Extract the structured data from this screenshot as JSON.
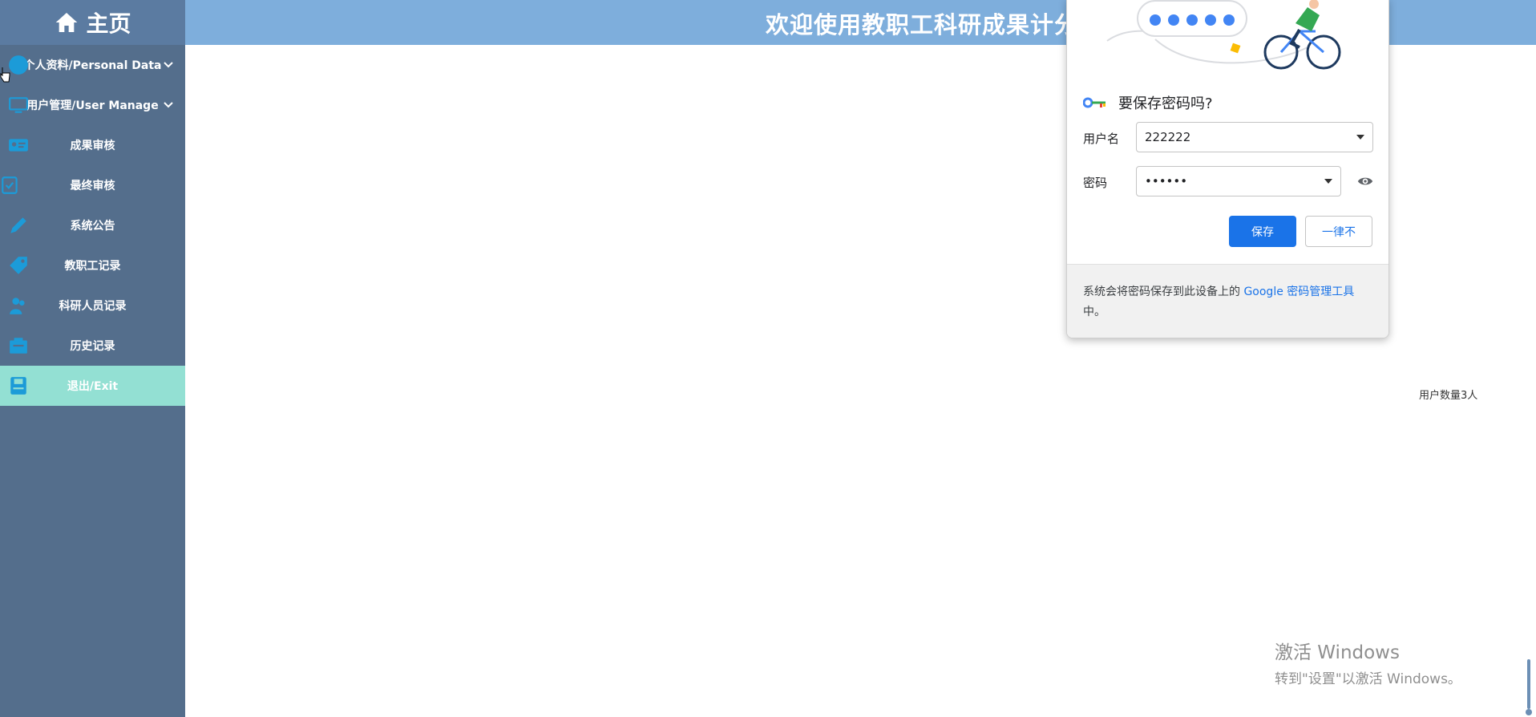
{
  "header": {
    "home_label": "主页",
    "page_heading": "欢迎使用教职工科研成果计分"
  },
  "sidebar": {
    "items": [
      {
        "label": "个人资料/Personal Data",
        "icon": "user-circle-icon",
        "expandable": true
      },
      {
        "label": "用户管理/User Manage",
        "icon": "monitor-icon",
        "expandable": true
      },
      {
        "label": "成果审核",
        "icon": "id-card-icon"
      },
      {
        "label": "最终审核",
        "icon": "check-doc-icon"
      },
      {
        "label": "系统公告",
        "icon": "edit-pen-icon"
      },
      {
        "label": "教职工记录",
        "icon": "tag-icon"
      },
      {
        "label": "科研人员记录",
        "icon": "people-icon"
      },
      {
        "label": "历史记录",
        "icon": "folder-icon"
      },
      {
        "label": "退出/Exit",
        "icon": "floppy-icon",
        "active": true
      }
    ]
  },
  "main": {
    "user_count": "用户数量3人"
  },
  "password_popup": {
    "title": "要保存密码吗?",
    "username_label": "用户名",
    "username_value": "222222",
    "password_label": "密码",
    "password_value": "••••••",
    "save_label": "保存",
    "never_label": "一律不",
    "footer_text": "系统会将密码保存到此设备上的",
    "footer_link": "Google 密码管理工具",
    "footer_suffix": "中。"
  },
  "watermark": {
    "line1": "激活 Windows",
    "line2": "转到\"设置\"以激活 Windows。"
  },
  "colors": {
    "header_bg": "#7eaedc",
    "home_bg": "#5b7ba1",
    "sidebar_bg": "#546e8c",
    "active_bg": "#93e0d3",
    "icon_color": "#1c9bd8",
    "primary_button": "#1a73e8"
  }
}
